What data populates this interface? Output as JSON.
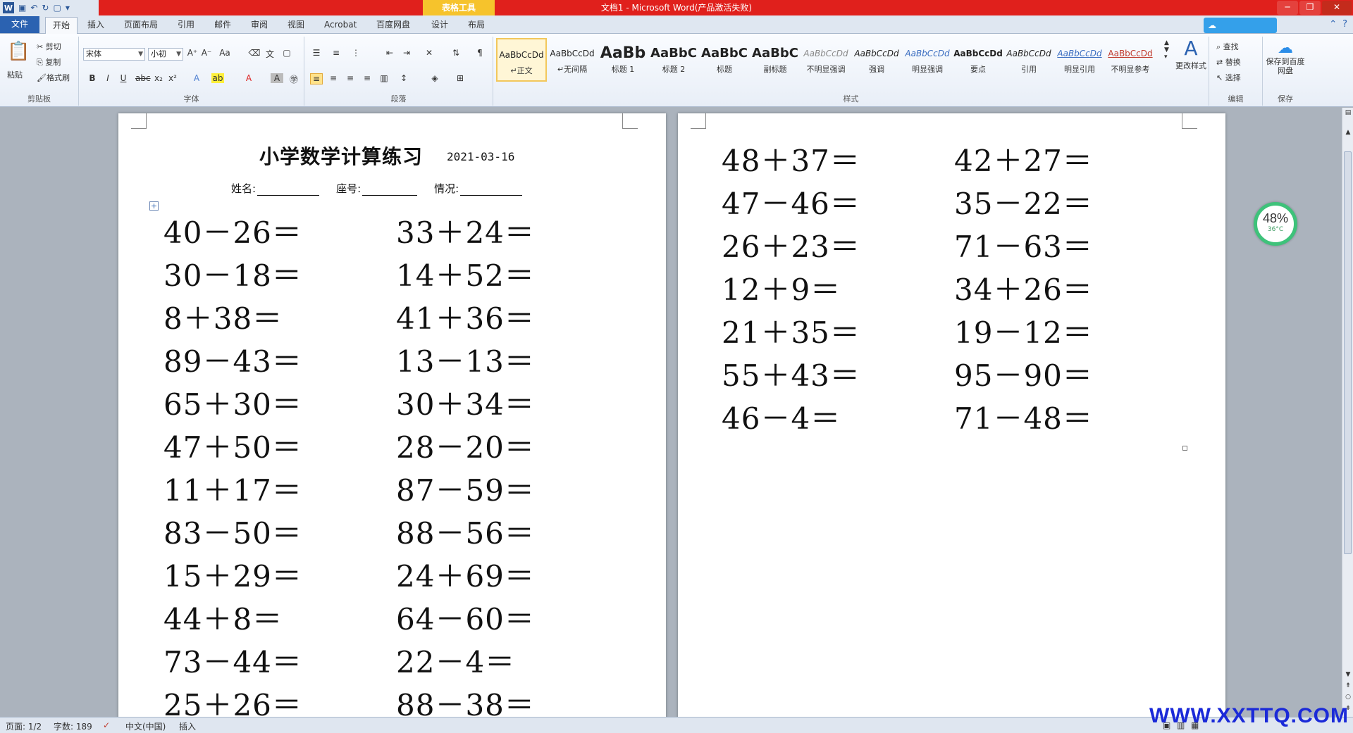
{
  "window": {
    "title": "文档1 - Microsoft Word(产品激活失败)",
    "contextual_tab": "表格工具",
    "qat_icons": [
      "word-icon",
      "save-icon",
      "undo-icon",
      "redo-icon",
      "new-icon"
    ]
  },
  "tabs": [
    {
      "label": "文件",
      "kind": "file"
    },
    {
      "label": "开始",
      "kind": "active"
    },
    {
      "label": "插入",
      "kind": ""
    },
    {
      "label": "页面布局",
      "kind": ""
    },
    {
      "label": "引用",
      "kind": ""
    },
    {
      "label": "邮件",
      "kind": ""
    },
    {
      "label": "审阅",
      "kind": ""
    },
    {
      "label": "视图",
      "kind": ""
    },
    {
      "label": "Acrobat",
      "kind": ""
    },
    {
      "label": "百度网盘",
      "kind": ""
    },
    {
      "label": "设计",
      "kind": ""
    },
    {
      "label": "布局",
      "kind": ""
    }
  ],
  "ribbon": {
    "clipboard": {
      "paste": "粘贴",
      "cut": "剪切",
      "copy": "复制",
      "format_painter": "格式刷",
      "label": "剪贴板"
    },
    "font": {
      "name": "宋体",
      "size": "小初",
      "label": "字体"
    },
    "paragraph": {
      "label": "段落"
    },
    "styles": {
      "label": "样式",
      "items": [
        {
          "sample": "AaBbCcDd",
          "name": "↵正文"
        },
        {
          "sample": "AaBbCcDd",
          "name": "↵无间隔"
        },
        {
          "sample": "AaBb",
          "name": "标题 1"
        },
        {
          "sample": "AaBbC",
          "name": "标题 2"
        },
        {
          "sample": "AaBbC",
          "name": "标题"
        },
        {
          "sample": "AaBbC",
          "name": "副标题"
        },
        {
          "sample": "AaBbCcDd",
          "name": "不明显强调"
        },
        {
          "sample": "AaBbCcDd",
          "name": "强调"
        },
        {
          "sample": "AaBbCcDd",
          "name": "明显强调"
        },
        {
          "sample": "AaBbCcDd",
          "name": "要点"
        },
        {
          "sample": "AaBbCcDd",
          "name": "引用"
        },
        {
          "sample": "AaBbCcDd",
          "name": "明显引用"
        },
        {
          "sample": "AaBbCcDd",
          "name": "不明显参考"
        }
      ],
      "change_styles": "更改样式"
    },
    "editing": {
      "find": "查找",
      "replace": "替换",
      "select": "选择",
      "label": "编辑"
    },
    "save": {
      "baidu": "保存到百度网盘",
      "label": "保存"
    }
  },
  "document": {
    "title": "小学数学计算练习",
    "date": "2021-03-16",
    "name_label": "姓名:",
    "seat_label": "座号:",
    "status_label": "情况:",
    "page1": {
      "left": [
        "40－26＝",
        "30－18＝",
        "8＋38＝",
        "89－43＝",
        "65＋30＝",
        "47＋50＝",
        "11＋17＝",
        "83－50＝",
        "15＋29＝",
        "44＋8＝",
        "73－44＝",
        "25＋26＝"
      ],
      "right": [
        "33＋24＝",
        "14＋52＝",
        "41＋36＝",
        "13－13＝",
        "30＋34＝",
        "28－20＝",
        "87－59＝",
        "88－56＝",
        "24＋69＝",
        "64－60＝",
        "22－4＝",
        "88－38＝"
      ]
    },
    "page2": {
      "left": [
        "48＋37＝",
        "47－46＝",
        "26＋23＝",
        "12＋9＝",
        "21＋35＝",
        "55＋43＝",
        "46－4＝"
      ],
      "right": [
        "42＋27＝",
        "35－22＝",
        "71－63＝",
        "34＋26＝",
        "19－12＝",
        "95－90＝",
        "71－48＝"
      ]
    }
  },
  "perf_widget": {
    "percent": "48%",
    "temp": "36°C"
  },
  "status": {
    "page": "页面: 1/2",
    "words": "字数: 189",
    "language": "中文(中国)",
    "mode": "插入"
  },
  "watermark": "WWW.XXTTQ.COM"
}
